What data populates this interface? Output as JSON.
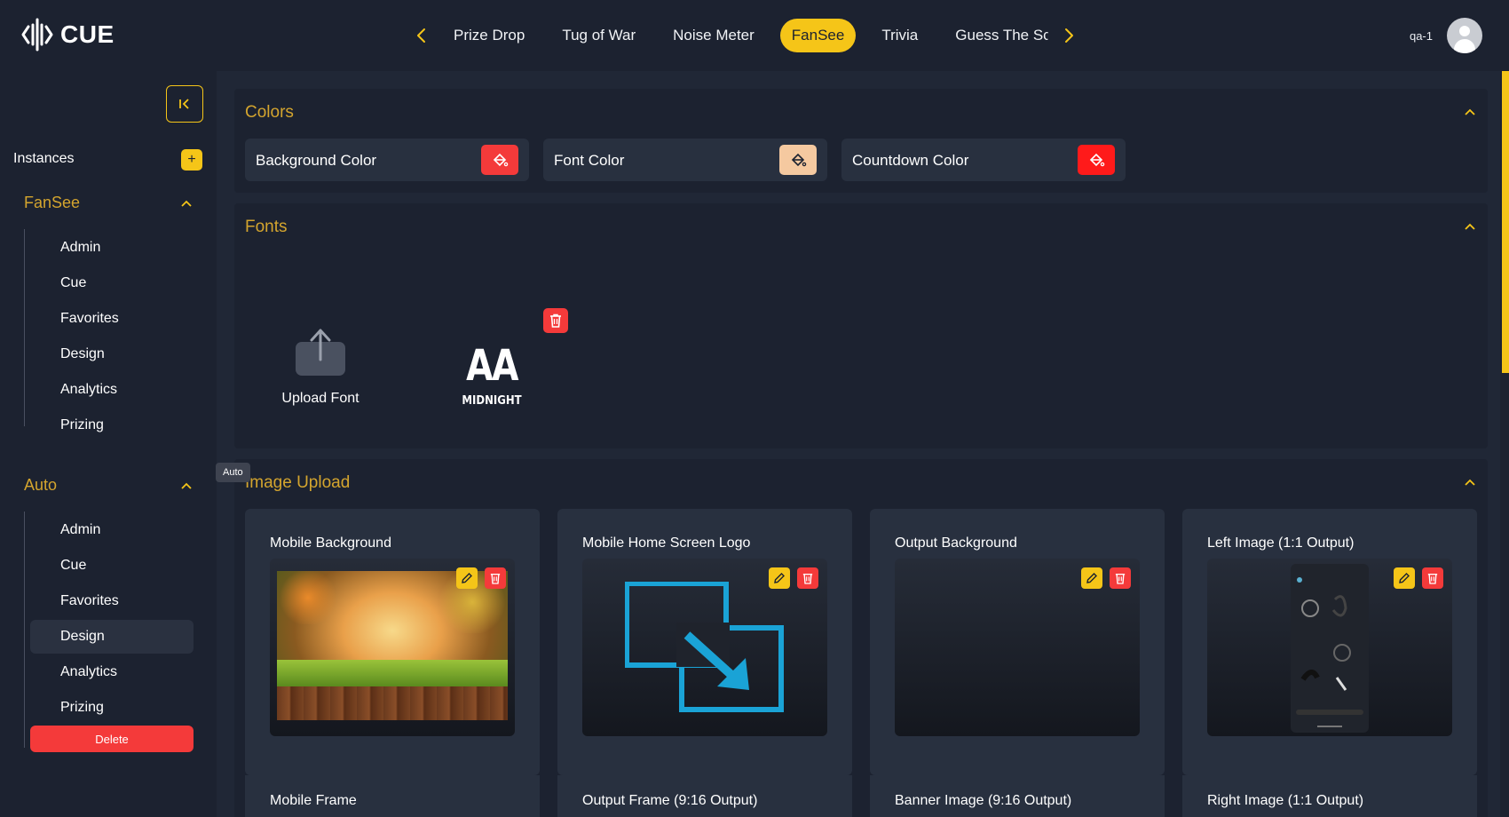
{
  "app": {
    "logo_text": "CUE",
    "user_name": "qa-1"
  },
  "nav": {
    "tabs": [
      {
        "label": "Prize Drop",
        "active": false
      },
      {
        "label": "Tug of War",
        "active": false
      },
      {
        "label": "Noise Meter",
        "active": false
      },
      {
        "label": "FanSee",
        "active": true
      },
      {
        "label": "Trivia",
        "active": false
      },
      {
        "label": "Guess The Sco",
        "active": false
      }
    ]
  },
  "sidebar": {
    "instances_label": "Instances",
    "tooltip": "Auto",
    "delete_label": "Delete",
    "groups": [
      {
        "title": "FanSee",
        "items": [
          "Admin",
          "Cue",
          "Favorites",
          "Design",
          "Analytics",
          "Prizing"
        ]
      },
      {
        "title": "Auto",
        "items": [
          "Admin",
          "Cue",
          "Favorites",
          "Design",
          "Analytics",
          "Prizing"
        ],
        "active_item": "Design"
      }
    ]
  },
  "colors_panel": {
    "title": "Colors",
    "cards": [
      {
        "label": "Background Color",
        "color": "#f43a3a"
      },
      {
        "label": "Font Color",
        "color": "#f5c9a0"
      },
      {
        "label": "Countdown Color",
        "color": "#ff1a1a"
      }
    ]
  },
  "fonts_panel": {
    "title": "Fonts",
    "upload_label": "Upload Font",
    "font_preview_glyph": "AA",
    "font_name": "MIDNIGHT"
  },
  "image_panel": {
    "title": "Image Upload",
    "cards": [
      {
        "label": "Mobile Background"
      },
      {
        "label": "Mobile Home Screen Logo"
      },
      {
        "label": "Output Background"
      },
      {
        "label": "Left Image (1:1 Output)"
      }
    ],
    "second_row": [
      {
        "label": "Mobile Frame"
      },
      {
        "label": "Output Frame (9:16 Output)"
      },
      {
        "label": "Banner Image (9:16 Output)"
      },
      {
        "label": "Right Image (1:1 Output)"
      }
    ]
  },
  "colors": {
    "accent": "#f5c518",
    "danger": "#f43a3a",
    "section_title": "#d4a52e",
    "background": "#1c2230"
  }
}
